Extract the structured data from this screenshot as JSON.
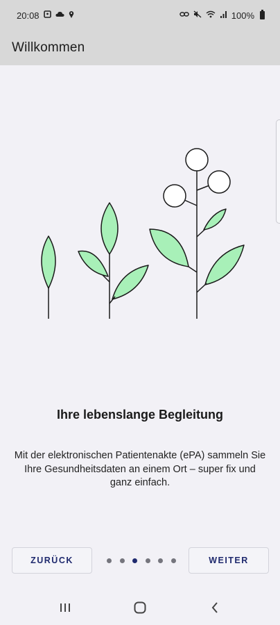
{
  "status_bar": {
    "time": "20:08",
    "battery": "100%",
    "left_icons": [
      "photo-icon",
      "cloud-icon",
      "location-icon"
    ],
    "right_icons": [
      "link-icon",
      "mute-icon",
      "wifi-icon",
      "signal-icon",
      "battery-icon"
    ]
  },
  "app_bar": {
    "title": "Willkommen"
  },
  "onboarding": {
    "headline": "Ihre lebenslange Begleitung",
    "body": "Mit der elektronischen Patientenakte (ePA) sammeln Sie Ihre Gesundheitsdaten an einem Ort – super fix und ganz einfach.",
    "illustration": "growing-plants-illustration",
    "colors": {
      "leaf_fill": "#a8f0b8",
      "stroke": "#1a1a1a",
      "accent": "#1f2a6e"
    }
  },
  "controls": {
    "back_label": "ZURÜCK",
    "next_label": "WEITER",
    "page_count": 6,
    "current_page": 3
  },
  "system_nav": {
    "buttons": [
      "recents-icon",
      "home-icon",
      "back-icon"
    ]
  }
}
